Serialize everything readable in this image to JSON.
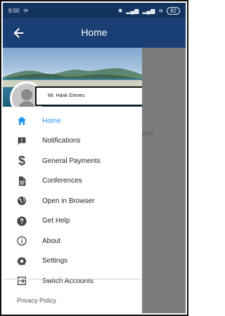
{
  "status_bar": {
    "time": "9:00",
    "battery": "82"
  },
  "app_bar": {
    "title": "Home"
  },
  "background": {
    "partial_text": "ms"
  },
  "drawer": {
    "user_name": "Mr. Hank Grimes",
    "items": [
      {
        "label": "Home",
        "icon": "home-icon",
        "active": true
      },
      {
        "label": "Notifications",
        "icon": "notifications-icon"
      },
      {
        "label": "General Payments",
        "icon": "dollar-icon"
      },
      {
        "label": "Conferences",
        "icon": "document-icon"
      },
      {
        "label": "Open in Browser",
        "icon": "globe-icon"
      },
      {
        "label": "Get Help",
        "icon": "help-icon"
      },
      {
        "label": "About",
        "icon": "info-icon"
      },
      {
        "label": "Settings",
        "icon": "gear-icon"
      },
      {
        "label": "Switch Accounts",
        "icon": "switch-icon"
      }
    ],
    "footer": {
      "privacy": "Privacy Policy"
    }
  },
  "colors": {
    "primary": "#1a3f74",
    "accent": "#2196f3"
  }
}
